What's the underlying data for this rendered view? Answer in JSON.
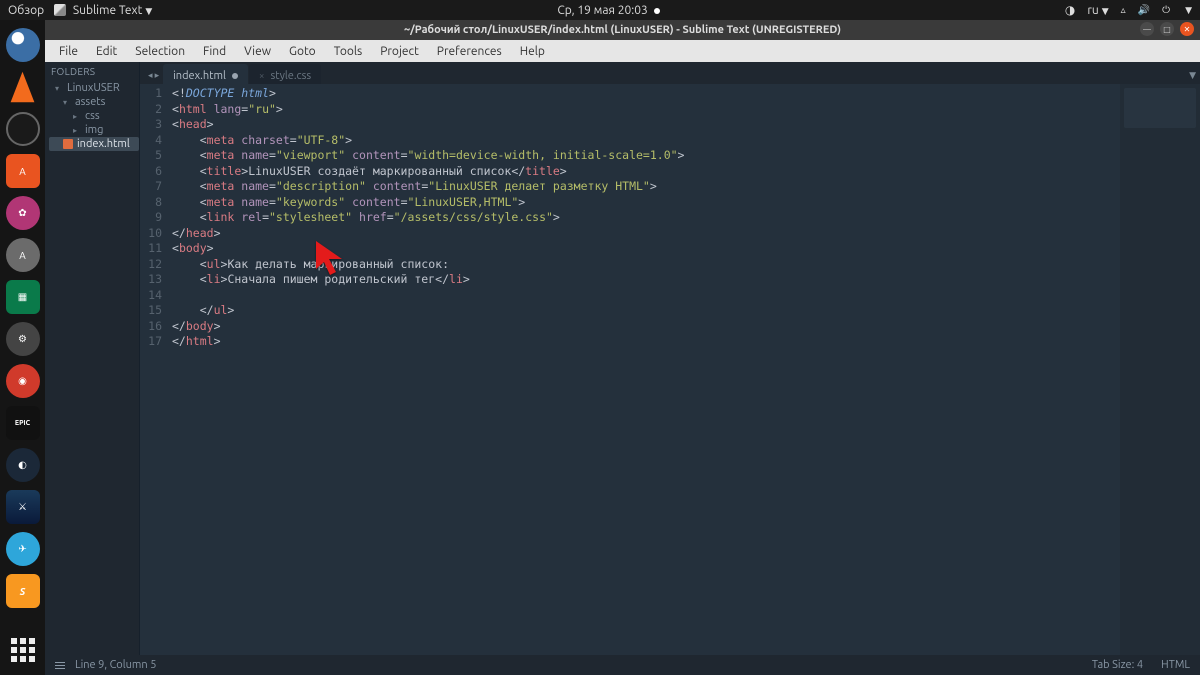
{
  "topbar": {
    "overview": "Обзор",
    "app_name": "Sublime Text",
    "clock": "Ср, 19 мая  20:03",
    "lang": "ru"
  },
  "dock": {
    "items": [
      {
        "name": "chromium",
        "bg": "#2c3e50",
        "label": "🌐"
      },
      {
        "name": "vlc",
        "bg": "#f26b1d",
        "label": "▶"
      },
      {
        "name": "obs",
        "bg": "#222",
        "label": "◯"
      },
      {
        "name": "ubuntu-software",
        "bg": "#e95420",
        "label": "A"
      },
      {
        "name": "app-pink",
        "bg": "#b13675",
        "label": "✿"
      },
      {
        "name": "software-updater",
        "bg": "#6b6b6b",
        "label": "↻"
      },
      {
        "name": "cpu-x",
        "bg": "#0a7a4a",
        "label": "▦"
      },
      {
        "name": "settings",
        "bg": "#444",
        "label": "⚙"
      },
      {
        "name": "app-red",
        "bg": "#d03a2b",
        "label": "◉"
      },
      {
        "name": "epic",
        "bg": "#111",
        "label": "EPIC"
      },
      {
        "name": "steam",
        "bg": "#1b2838",
        "label": "◐"
      },
      {
        "name": "battlenet",
        "bg": "#1a3a5a",
        "label": "⚔"
      },
      {
        "name": "telegram",
        "bg": "#2ea6da",
        "label": "✈"
      },
      {
        "name": "sublime",
        "bg": "#f89820",
        "label": "S"
      }
    ]
  },
  "window": {
    "title": "~/Рабочий стол/LinuxUSER/index.html (LinuxUSER) - Sublime Text (UNREGISTERED)"
  },
  "menubar": {
    "items": [
      "File",
      "Edit",
      "Selection",
      "Find",
      "View",
      "Goto",
      "Tools",
      "Project",
      "Preferences",
      "Help"
    ]
  },
  "sidebar": {
    "header": "FOLDERS",
    "root": "LinuxUSER",
    "assets": "assets",
    "css": "css",
    "img": "img",
    "index": "index.html"
  },
  "tabs": [
    {
      "label": "index.html",
      "active": true,
      "dirty": true
    },
    {
      "label": "style.css",
      "active": false,
      "dirty": false
    }
  ],
  "code": {
    "lines_count": 17,
    "l1_doctype": "DOCTYPE html",
    "l2_attr": "lang",
    "l2_val": "\"ru\"",
    "l4_attr": "charset",
    "l4_val": "\"UTF-8\"",
    "l5_name": "name",
    "l5_nv": "\"viewport\"",
    "l5_content": "content",
    "l5_cv": "\"width=device-width, initial-scale=1.0\"",
    "l6_text": "LinuxUSER создаёт маркированный список",
    "l7_nv": "\"description\"",
    "l7_cv": "\"LinuxUSER делает разметку HTML\"",
    "l8_nv": "\"keywords\"",
    "l8_cv": "\"LinuxUSER,HTML\"",
    "l9_rel": "rel",
    "l9_rv": "\"stylesheet\"",
    "l9_href": "href",
    "l9_hv": "\"/assets/css/style.css\"",
    "l12_text": "Как делать маркированный список:",
    "l13_text": "Сначала пишем родительский тег",
    "tags": {
      "html": "html",
      "head": "head",
      "meta": "meta",
      "title": "title",
      "link": "link",
      "body": "body",
      "ul": "ul",
      "li": "li"
    }
  },
  "status": {
    "pos": "Line 9, Column 5",
    "tabsize": "Tab Size: 4",
    "syntax": "HTML"
  }
}
